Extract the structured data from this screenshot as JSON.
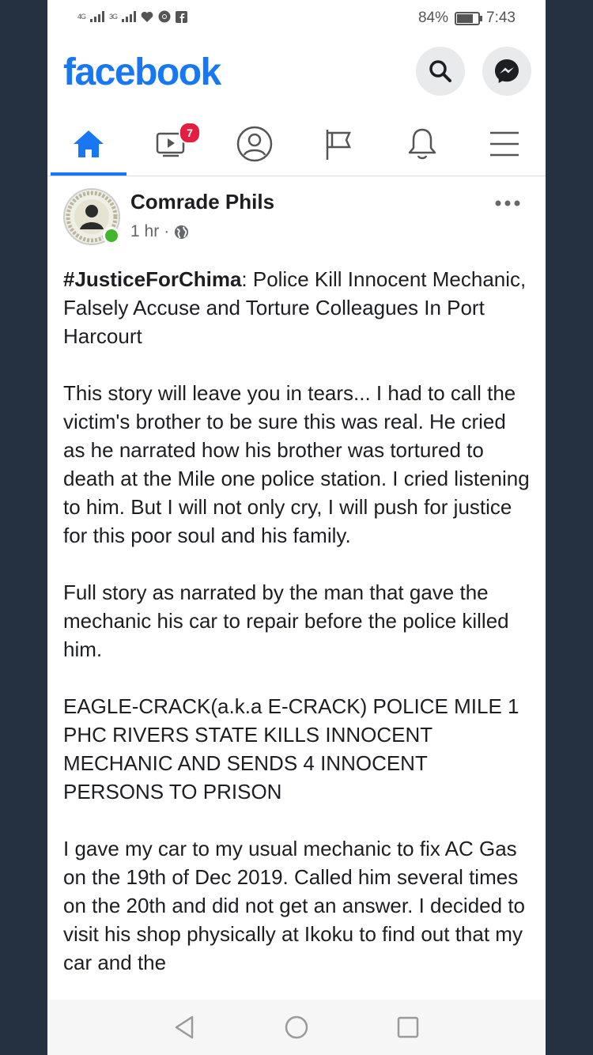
{
  "status_bar": {
    "signal1": "4G",
    "signal2": "3G",
    "battery_percent": "84%",
    "battery_level": 0.84,
    "time": "7:43"
  },
  "header": {
    "logo": "facebook",
    "brand_color": "#1877f2",
    "icons": [
      "search-icon",
      "messenger-icon"
    ]
  },
  "nav": {
    "tabs": [
      {
        "name": "home",
        "icon": "home-icon",
        "active": true
      },
      {
        "name": "watch",
        "icon": "video-icon",
        "badge": "7"
      },
      {
        "name": "profile",
        "icon": "profile-icon"
      },
      {
        "name": "pages",
        "icon": "flag-icon"
      },
      {
        "name": "notifications",
        "icon": "bell-icon"
      },
      {
        "name": "menu",
        "icon": "hamburger-icon"
      }
    ]
  },
  "post": {
    "author": "Comrade Phils",
    "time": "1 hr",
    "separator": "·",
    "hashtag": "#JusticeForChima",
    "headline_rest": ": Police Kill Innocent Mechanic, Falsely Accuse and Torture Colleagues In Port Harcourt",
    "paragraph1": "This story will leave you in tears... I had to call the victim's brother to be sure this was real. He cried as he narrated how his brother was tortured to death at the Mile one police station. I cried listening to him. But I will not only cry, I will push for justice for this poor soul and his family.",
    "paragraph2": "Full story as narrated by the man that gave the mechanic his car to repair before the police killed him.",
    "paragraph3": "EAGLE-CRACK(a.k.a E-CRACK) POLICE  MILE 1 PHC RIVERS STATE KILLS INNOCENT MECHANIC AND SENDS 4  INNOCENT PERSONS TO PRISON",
    "paragraph4": "I gave my car to my usual mechanic to fix AC Gas on the 19th of Dec 2019. Called him several times on the 20th and did not get an answer. I decided to visit his shop physically at Ikoku  to find out   that my car and the"
  },
  "bottom_nav": {
    "icons": [
      "back-icon",
      "home-circle-icon",
      "recents-icon"
    ]
  }
}
